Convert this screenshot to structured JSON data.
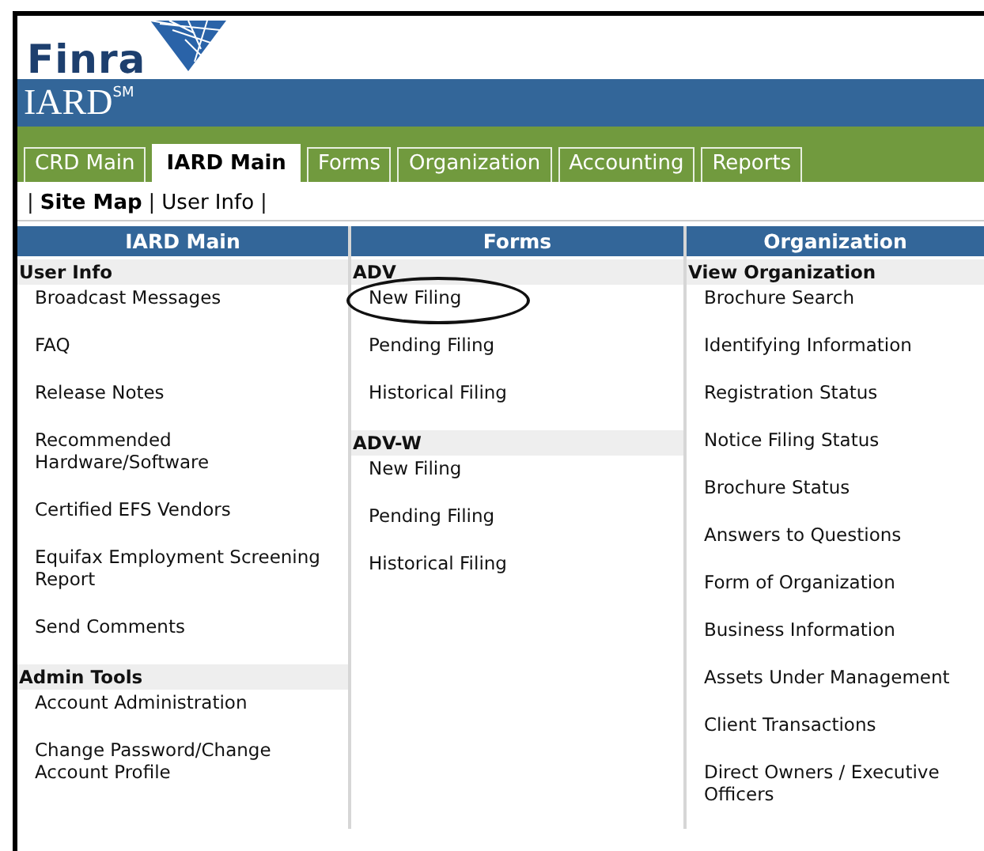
{
  "logo": {
    "text": "Finra"
  },
  "product": {
    "name": "IARD$^{SM}$"
  },
  "tabs": [
    {
      "label": "CRD Main",
      "selected": false
    },
    {
      "label": "IARD Main",
      "selected": true
    },
    {
      "label": "Forms",
      "selected": false
    },
    {
      "label": "Organization",
      "selected": false
    },
    {
      "label": "Accounting",
      "selected": false
    },
    {
      "label": "Reports",
      "selected": false
    }
  ],
  "subnav": {
    "separator": "|",
    "links": [
      {
        "label": "Site Map",
        "selected": true
      },
      {
        "label": "User Info",
        "selected": false
      }
    ]
  },
  "columns": [
    {
      "title": "IARD Main",
      "groups": [
        {
          "heading": "User Info",
          "items": [
            {
              "label": "Broadcast Messages",
              "circled": false
            },
            {
              "label": "FAQ",
              "circled": false
            },
            {
              "label": "Release Notes",
              "circled": false
            },
            {
              "label": "Recommended Hardware/Software",
              "circled": false
            },
            {
              "label": "Certified EFS Vendors",
              "circled": false
            },
            {
              "label": "Equifax Employment Screening Report",
              "circled": false
            },
            {
              "label": "Send Comments",
              "circled": false
            }
          ]
        },
        {
          "heading": "Admin Tools",
          "items": [
            {
              "label": "Account Administration",
              "circled": false
            },
            {
              "label": "Change Password/Change Account Profile",
              "circled": false
            }
          ]
        }
      ]
    },
    {
      "title": "Forms",
      "groups": [
        {
          "heading": "ADV",
          "items": [
            {
              "label": "New Filing",
              "circled": true
            },
            {
              "label": "Pending Filing",
              "circled": false
            },
            {
              "label": "Historical Filing",
              "circled": false
            }
          ]
        },
        {
          "heading": "ADV-W",
          "items": [
            {
              "label": "New Filing",
              "circled": false
            },
            {
              "label": "Pending Filing",
              "circled": false
            },
            {
              "label": "Historical Filing",
              "circled": false
            }
          ]
        }
      ]
    },
    {
      "title": "Organization",
      "groups": [
        {
          "heading": "View Organization",
          "items": [
            {
              "label": "Brochure Search",
              "circled": false
            },
            {
              "label": "Identifying Information",
              "circled": false
            },
            {
              "label": "Registration Status",
              "circled": false
            },
            {
              "label": "Notice Filing Status",
              "circled": false
            },
            {
              "label": "Brochure Status",
              "circled": false
            },
            {
              "label": "Answers to Questions",
              "circled": false
            },
            {
              "label": "Form of Organization",
              "circled": false
            },
            {
              "label": "Business Information",
              "circled": false
            },
            {
              "label": "Assets Under Management",
              "circled": false
            },
            {
              "label": "Client Transactions",
              "circled": false
            },
            {
              "label": "Direct Owners / Executive Officers",
              "circled": false
            }
          ]
        }
      ]
    }
  ]
}
